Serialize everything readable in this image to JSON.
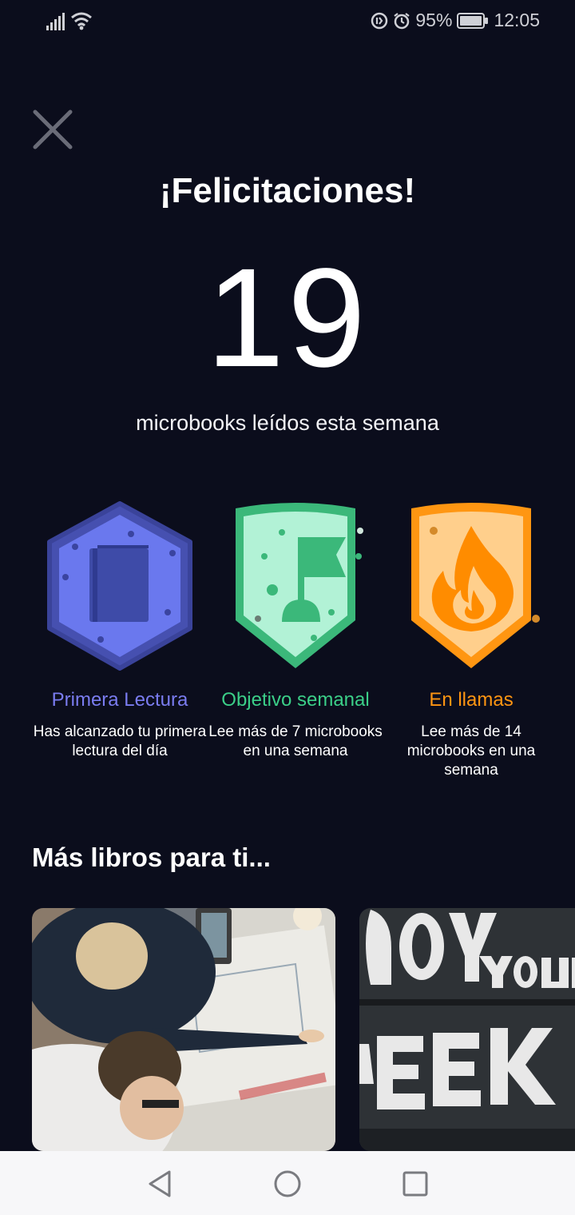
{
  "status_bar": {
    "battery": "95%",
    "time": "12:05"
  },
  "header": {
    "title": "¡Felicitaciones!",
    "count": "19",
    "subtitle": "microbooks leídos esta semana"
  },
  "badges": [
    {
      "name": "Primera Lectura",
      "description": "Has alcanzado tu primera lectura del día",
      "color": "#7a7cf0",
      "icon": "book-icon"
    },
    {
      "name": "Objetivo semanal",
      "description": "Lee más de 7 microbooks en una semana",
      "color": "#3bcf88",
      "icon": "flag-icon"
    },
    {
      "name": "En llamas",
      "description": "Lee más de 14 microbooks en una semana",
      "color": "#ff9612",
      "icon": "fire-icon"
    }
  ],
  "recommendations": {
    "title": "Más libros para ti...",
    "cards": [
      {
        "image": "office-planning-photo"
      },
      {
        "image": "enjoy-your-week-sign-photo"
      }
    ]
  },
  "colors": {
    "background": "#0b0d1c",
    "text": "#ffffff",
    "navbar": "#f7f7f9"
  }
}
